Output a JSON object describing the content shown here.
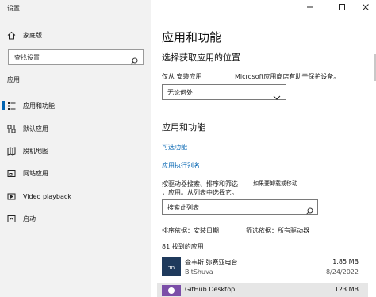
{
  "window": {
    "title": "设置"
  },
  "sidebar": {
    "home_label": "家庭版",
    "search_placeholder": "查找设置",
    "section_label": "应用",
    "items": [
      {
        "label": "应用和功能",
        "icon": "apps-list-icon",
        "active": true
      },
      {
        "label": "默认应用",
        "icon": "default-apps-icon",
        "active": false
      },
      {
        "label": "脱机地图",
        "icon": "offline-maps-icon",
        "active": false
      },
      {
        "label": "网站应用",
        "icon": "apps-for-websites-icon",
        "active": false
      },
      {
        "label": "Video playback",
        "icon": "video-playback-icon",
        "active": false
      },
      {
        "label": "启动",
        "icon": "startup-icon",
        "active": false
      }
    ]
  },
  "main": {
    "title": "应用和功能",
    "choose_heading": "选择获取应用的位置",
    "source_label": "仅从 安装应用",
    "source_note": "Microsoft应用商店有助于保护设备。",
    "location_value": "无论何处",
    "apps_heading": "应用和功能",
    "optional_features": "可选功能",
    "app_aliases": "应用执行别名",
    "search_hint_line1": "按驱动器搜索、排序和筛选",
    "search_hint_line2": "，应用。从列表中选择它。",
    "move_note": "如果要卸载或移动",
    "search_list_placeholder": "搜索此列表",
    "sort_label": "排序依据：安装日期",
    "filter_label": "筛选依据：所有驱动器",
    "apps_found": "81 找到的应用",
    "apps": [
      {
        "name": "查韦斯 弥赛亚电台",
        "publisher": "BitShuva",
        "size": "1.85 MB",
        "date": "8/24/2022"
      },
      {
        "name": "GitHub Desktop",
        "publisher": "",
        "size": "123 MB",
        "date": ""
      }
    ]
  },
  "colors": {
    "accent": "#0063b1",
    "sidebar_bg": "#f2f2f2",
    "selected_row": "#e6e6e6"
  }
}
